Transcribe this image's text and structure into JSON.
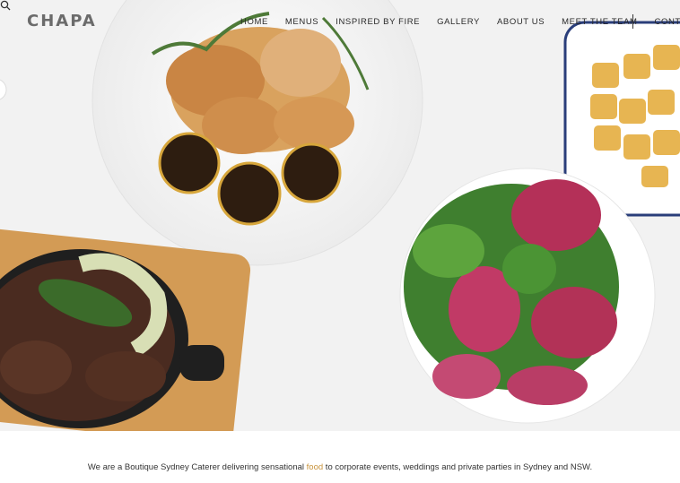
{
  "brand": {
    "logo_text": "CHAPA"
  },
  "nav": {
    "items": [
      {
        "label": "HOME"
      },
      {
        "label": "MENUS"
      },
      {
        "label": "INSPIRED BY FIRE"
      },
      {
        "label": "GALLERY"
      },
      {
        "label": "ABOUT US"
      },
      {
        "label": "MEET THE TEAM"
      },
      {
        "label": "CONTACT"
      }
    ],
    "search_icon": "search-icon"
  },
  "intro": {
    "before": "We are a Boutique Sydney Caterer delivering sensational ",
    "highlight": "food",
    "after": " to corporate events, weddings and private parties in Sydney and NSW."
  },
  "colors": {
    "accent": "#c8933c",
    "text": "#333333",
    "logo": "#6b6b6b"
  }
}
